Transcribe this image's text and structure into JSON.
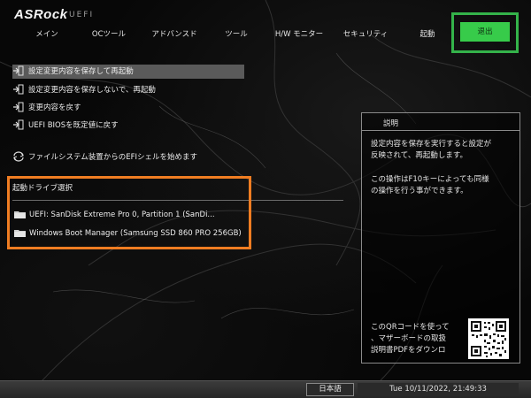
{
  "header": {
    "brand": "ASRock",
    "brand_sub": "UEFI",
    "tabs": [
      {
        "label": "メイン"
      },
      {
        "label": "OCツール"
      },
      {
        "label": "アドバンスド"
      },
      {
        "label": "ツール"
      },
      {
        "label": "H/W モニター"
      },
      {
        "label": "セキュリティ"
      },
      {
        "label": "起動"
      },
      {
        "label": "退出",
        "active": true
      }
    ]
  },
  "menu": {
    "items": [
      {
        "label": "設定変更内容を保存して再起動",
        "icon": "exit-save-icon",
        "selected": true
      },
      {
        "label": "設定変更内容を保存しないで、再起動",
        "icon": "exit-icon"
      },
      {
        "label": "変更内容を戻す",
        "icon": "exit-icon"
      },
      {
        "label": "UEFI BIOSを既定値に戻す",
        "icon": "exit-icon"
      },
      {
        "label": "ファイルシステム装置からのEFIシェルを始めます",
        "icon": "refresh-icon"
      }
    ]
  },
  "boot": {
    "title": "起動ドライブ選択",
    "items": [
      {
        "label": "UEFI: SanDisk Extreme Pro 0, Partition 1 (SanDi...",
        "icon": "folder-icon"
      },
      {
        "label": "Windows Boot Manager (Samsung SSD 860 PRO 256GB)",
        "icon": "folder-icon"
      }
    ]
  },
  "panel": {
    "title": "説明",
    "desc1": "設定内容を保存を実行すると設定が\n反映されて、再起動します。",
    "desc2": "この操作はF10キーによっても同様\nの操作を行う事ができます。",
    "qr_text": "このQRコードを使って\n、マザーボードの取扱\n説明書PDFをダウンロ"
  },
  "footer": {
    "language": "日本語",
    "datetime": "Tue 10/11/2022, 21:49:33"
  },
  "colors": {
    "accent_green": "#37cb4a",
    "highlight_green_box": "#34b34a",
    "highlight_orange_box": "#f07d22",
    "selected_row": "#5a5a5a"
  }
}
